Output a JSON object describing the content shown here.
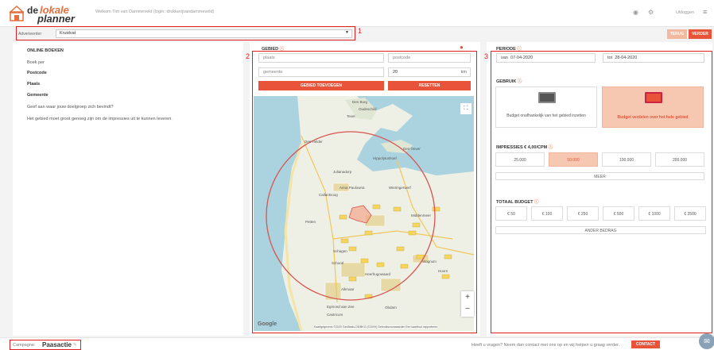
{
  "header": {
    "logo_de": "de",
    "logo_lokale": "lokale",
    "logo_planner": "planner",
    "welcome": "Welkom Tim van Dammeveld (login: drukkerijvandammeveld)",
    "logout": "Uitloggen"
  },
  "advertiser": {
    "label": "Adverteerder:",
    "value": "Kruidvat"
  },
  "annotations": {
    "one": "1",
    "two": "2",
    "three": "3"
  },
  "nav": {
    "back": "TERUG",
    "next": "VERDER"
  },
  "online": {
    "title": "ONLINE BOEKEN",
    "lines": [
      "Boek per",
      "Postcode",
      "Plaats",
      "Gemeente",
      "Geef aan waar jouw doelgroep zich bevindt?",
      "Het gebied moet groot genoeg zijn om de impressies uit te kunnen leveren."
    ]
  },
  "gebied": {
    "title": "GEBIED",
    "place_placeholder": "plaats",
    "postcode_placeholder": "postcode",
    "municipality_placeholder": "gemeente",
    "radius": "20",
    "radius_unit": "km",
    "add_button": "GEBIED TOEVOEGEN",
    "reset_button": "RESETTEN"
  },
  "map": {
    "places": [
      "Den Burg",
      "Oudeschild",
      "Texel",
      "Den Helder",
      "Den Oever",
      "Hippolytushoef",
      "Julianadorp",
      "Anna Paulowna",
      "Wieringerwerf",
      "Callantsoog",
      "Schagen",
      "Middenmeer",
      "Petten",
      "Schoorl",
      "Heerhugowaard",
      "Alkmaar",
      "Egmond aan Zee",
      "Castricum",
      "Wognum",
      "Obdam",
      "Hoorn"
    ],
    "zoom_in": "+",
    "zoom_out": "−",
    "google": "Google",
    "footer": "Kaartgegevens ©2020 GeoBasis-DE/BKG (©2009)   Gebruiksvoorwaarden   Een kaartfout rapporteren"
  },
  "periode": {
    "title": "PERIODE",
    "from_label": "van",
    "from_value": "07-04-2020",
    "to_label": "tot",
    "to_value": "28-04-2020"
  },
  "gebruik": {
    "title": "GEBRUIK",
    "option_a": "Budget onafhankelijk van het gebied inzetten",
    "option_b": "Budget verdelen over het hele gebied"
  },
  "impressies": {
    "title": "IMPRESSIES € 4,00/CPM",
    "options": [
      "25.000",
      "50.000",
      "100.000",
      "200.000"
    ],
    "more": "MEER"
  },
  "budget": {
    "title": "TOTAAL BUDGET",
    "options": [
      "€ 50",
      "€ 100",
      "€ 250",
      "€ 500",
      "€ 1000",
      "€ 2500"
    ],
    "other": "ANDER BEDRAG"
  },
  "footer": {
    "campaign_label": "Campagne:",
    "campaign_name": "Paasactie",
    "help": "Heeft u vragen? Neem dan contact met ons op en wij helpen u graag verder.",
    "contact": "CONTACT"
  },
  "colors": {
    "accent": "#e8533a",
    "accent_light": "#f6c8b2",
    "annotation": "#e02020"
  }
}
